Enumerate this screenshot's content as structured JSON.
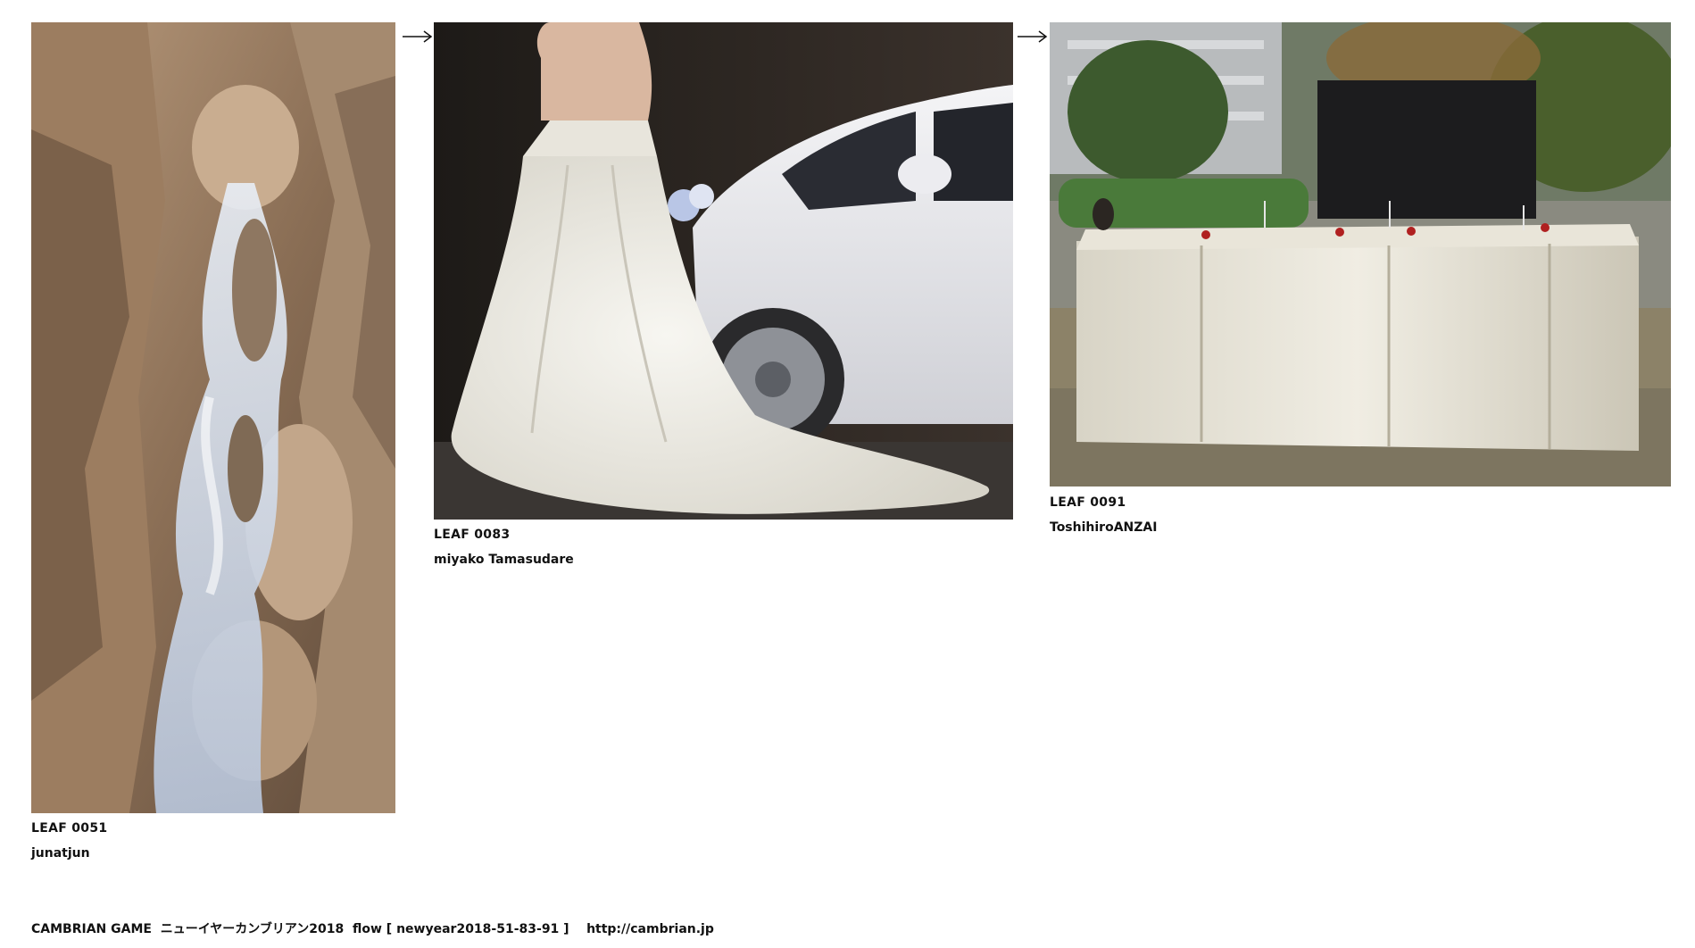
{
  "leaves": [
    {
      "id": "LEAF 0051",
      "author": "junatjun",
      "image": "waterfall-photo"
    },
    {
      "id": "LEAF 0083",
      "author": "miyako Tamasudare",
      "image": "wedding-dress-car-photo"
    },
    {
      "id": "LEAF 0091",
      "author": "ToshihiroANZAI",
      "image": "banquet-table-photo"
    }
  ],
  "arrows": [
    "arrow-right-icon",
    "arrow-right-icon"
  ],
  "footer": {
    "text": "CAMBRIAN GAME  ニューイヤーカンブリアン2018  flow [ newyear2018-51-83-91 ]    http://cambrian.jp"
  }
}
